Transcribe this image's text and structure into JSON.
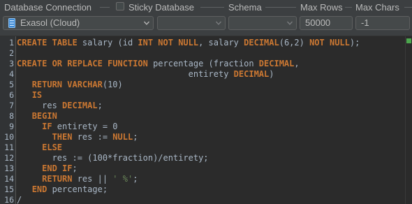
{
  "toolbar": {
    "connection_label": "Database Connection",
    "sticky_label": "Sticky Database",
    "schema_label": "Schema",
    "max_rows_label": "Max Rows",
    "max_chars_label": "Max Chars",
    "connection_value": "Exasol (Cloud)",
    "database_value": "",
    "schema_value": "",
    "max_rows_value": "50000",
    "max_chars_value": "-1",
    "sticky_checked": false
  },
  "colors": {
    "keyword": "#cc7832",
    "plain": "#a9b7c6",
    "string": "#6a8759",
    "editor_bg": "#2b2b2b",
    "gutter_bg": "#313335",
    "status_ok": "#4ca74e"
  },
  "editor": {
    "line_numbers": [
      "1",
      "2",
      "3",
      "4",
      "5",
      "6",
      "7",
      "8",
      "9",
      "10",
      "11",
      "12",
      "13",
      "14",
      "15",
      "16"
    ],
    "lines": [
      [
        {
          "t": "CREATE TABLE",
          "k": "kw"
        },
        {
          "t": " salary (id "
        },
        {
          "t": "INT NOT NULL",
          "k": "kw"
        },
        {
          "t": ", salary "
        },
        {
          "t": "DECIMAL",
          "k": "kw"
        },
        {
          "t": "(6,2) "
        },
        {
          "t": "NOT NULL",
          "k": "kw"
        },
        {
          "t": ");"
        }
      ],
      [],
      [
        {
          "t": "CREATE OR REPLACE FUNCTION",
          "k": "kw"
        },
        {
          "t": " percentage (fraction "
        },
        {
          "t": "DECIMAL",
          "k": "kw"
        },
        {
          "t": ","
        }
      ],
      [
        {
          "t": "                                  entirety "
        },
        {
          "t": "DECIMAL",
          "k": "kw"
        },
        {
          "t": ")"
        }
      ],
      [
        {
          "t": "   "
        },
        {
          "t": "RETURN VARCHAR",
          "k": "kw"
        },
        {
          "t": "(10)"
        }
      ],
      [
        {
          "t": "   "
        },
        {
          "t": "IS",
          "k": "kw"
        }
      ],
      [
        {
          "t": "     res "
        },
        {
          "t": "DECIMAL",
          "k": "kw"
        },
        {
          "t": ";"
        }
      ],
      [
        {
          "t": "   "
        },
        {
          "t": "BEGIN",
          "k": "kw"
        }
      ],
      [
        {
          "t": "     "
        },
        {
          "t": "IF",
          "k": "kw"
        },
        {
          "t": " entirety = 0"
        }
      ],
      [
        {
          "t": "       "
        },
        {
          "t": "THEN",
          "k": "kw"
        },
        {
          "t": " res := "
        },
        {
          "t": "NULL",
          "k": "kw"
        },
        {
          "t": ";"
        }
      ],
      [
        {
          "t": "     "
        },
        {
          "t": "ELSE",
          "k": "kw"
        }
      ],
      [
        {
          "t": "       res := (100*fraction)/entirety;"
        }
      ],
      [
        {
          "t": "     "
        },
        {
          "t": "END IF",
          "k": "kw"
        },
        {
          "t": ";"
        }
      ],
      [
        {
          "t": "     "
        },
        {
          "t": "RETURN",
          "k": "kw"
        },
        {
          "t": " res || "
        },
        {
          "t": "' %'",
          "k": "st"
        },
        {
          "t": ";"
        }
      ],
      [
        {
          "t": "   "
        },
        {
          "t": "END",
          "k": "kw"
        },
        {
          "t": " percentage;"
        }
      ],
      [
        {
          "t": "/"
        }
      ]
    ]
  }
}
